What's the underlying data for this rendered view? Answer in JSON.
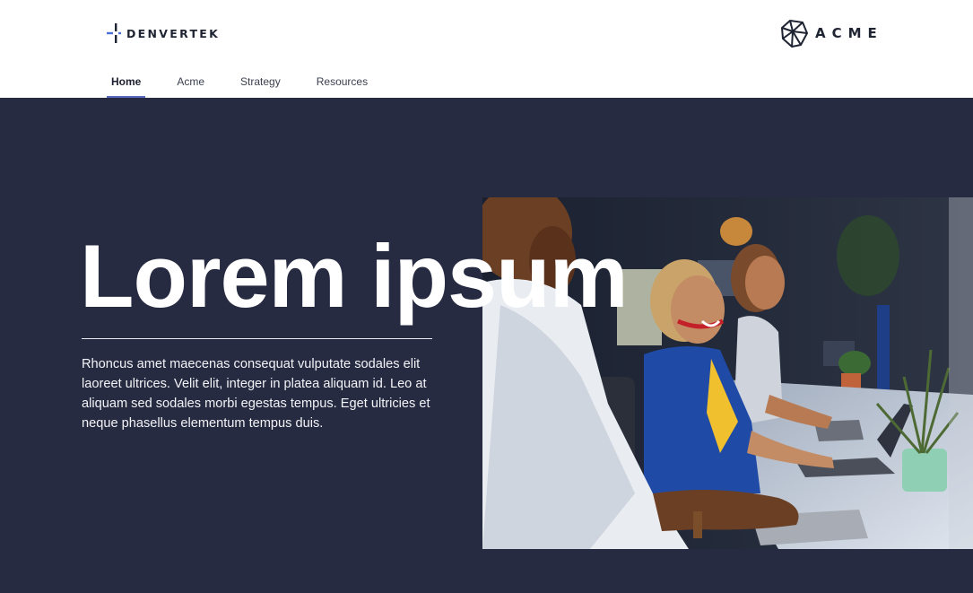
{
  "header": {
    "brand_left": "DENVERTEK",
    "brand_right": "ACME"
  },
  "nav": {
    "items": [
      {
        "label": "Home",
        "active": true
      },
      {
        "label": "Acme",
        "active": false
      },
      {
        "label": "Strategy",
        "active": false
      },
      {
        "label": "Resources",
        "active": false
      }
    ]
  },
  "hero": {
    "title": "Lorem ipsum",
    "body": "Rhoncus amet maecenas consequat vulputate sodales elit laoreet ultrices. Velit elit, integer in platea aliquam id. Leo at aliquam sed sodales morbi egestas tempus. Eget ultricies et neque phasellus elementum tempus duis.",
    "image_icon": "office-team-photo"
  },
  "colors": {
    "hero_bg": "#272b41",
    "nav_active_underline": "#5968c2",
    "logo_accent": "#4a6fd6",
    "text_dark": "#1f2433"
  }
}
